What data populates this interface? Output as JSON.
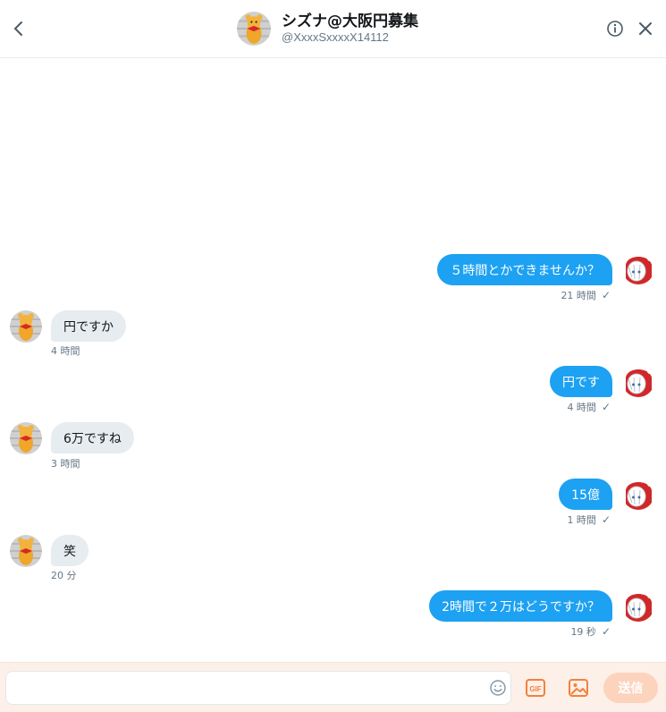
{
  "header": {
    "name": "シズナ@大阪円募集",
    "handle": "@XxxxSxxxxX14112"
  },
  "icons": {
    "back": "chevron-left-icon",
    "info": "info-circle-icon",
    "close": "close-icon",
    "emoji": "emoji-icon",
    "gif": "gif-icon",
    "image": "image-icon"
  },
  "messages": [
    {
      "direction": "sent",
      "text": "５時間とかできませんか？",
      "time": "21 時間",
      "status": "✓"
    },
    {
      "direction": "received",
      "text": "円ですか",
      "time": "4 時間"
    },
    {
      "direction": "sent",
      "text": "円です",
      "time": "4 時間",
      "status": "✓"
    },
    {
      "direction": "received",
      "text": "6万ですね",
      "time": "3 時間"
    },
    {
      "direction": "sent",
      "text": "15億",
      "time": "1 時間",
      "status": "✓"
    },
    {
      "direction": "received",
      "text": "笑",
      "time": "20 分"
    },
    {
      "direction": "sent",
      "text": "2時間で２万はどうですか？",
      "time": "19 秒",
      "status": "✓"
    }
  ],
  "composer": {
    "placeholder": "",
    "gif_label": "GIF",
    "send_label": "送信"
  },
  "colors": {
    "sent_bubble": "#1da1f2",
    "received_bubble": "#e6ecf0",
    "composer_bg": "#fdf0e8",
    "accent_orange": "#f4803c",
    "send_disabled": "#fcd4bd"
  }
}
